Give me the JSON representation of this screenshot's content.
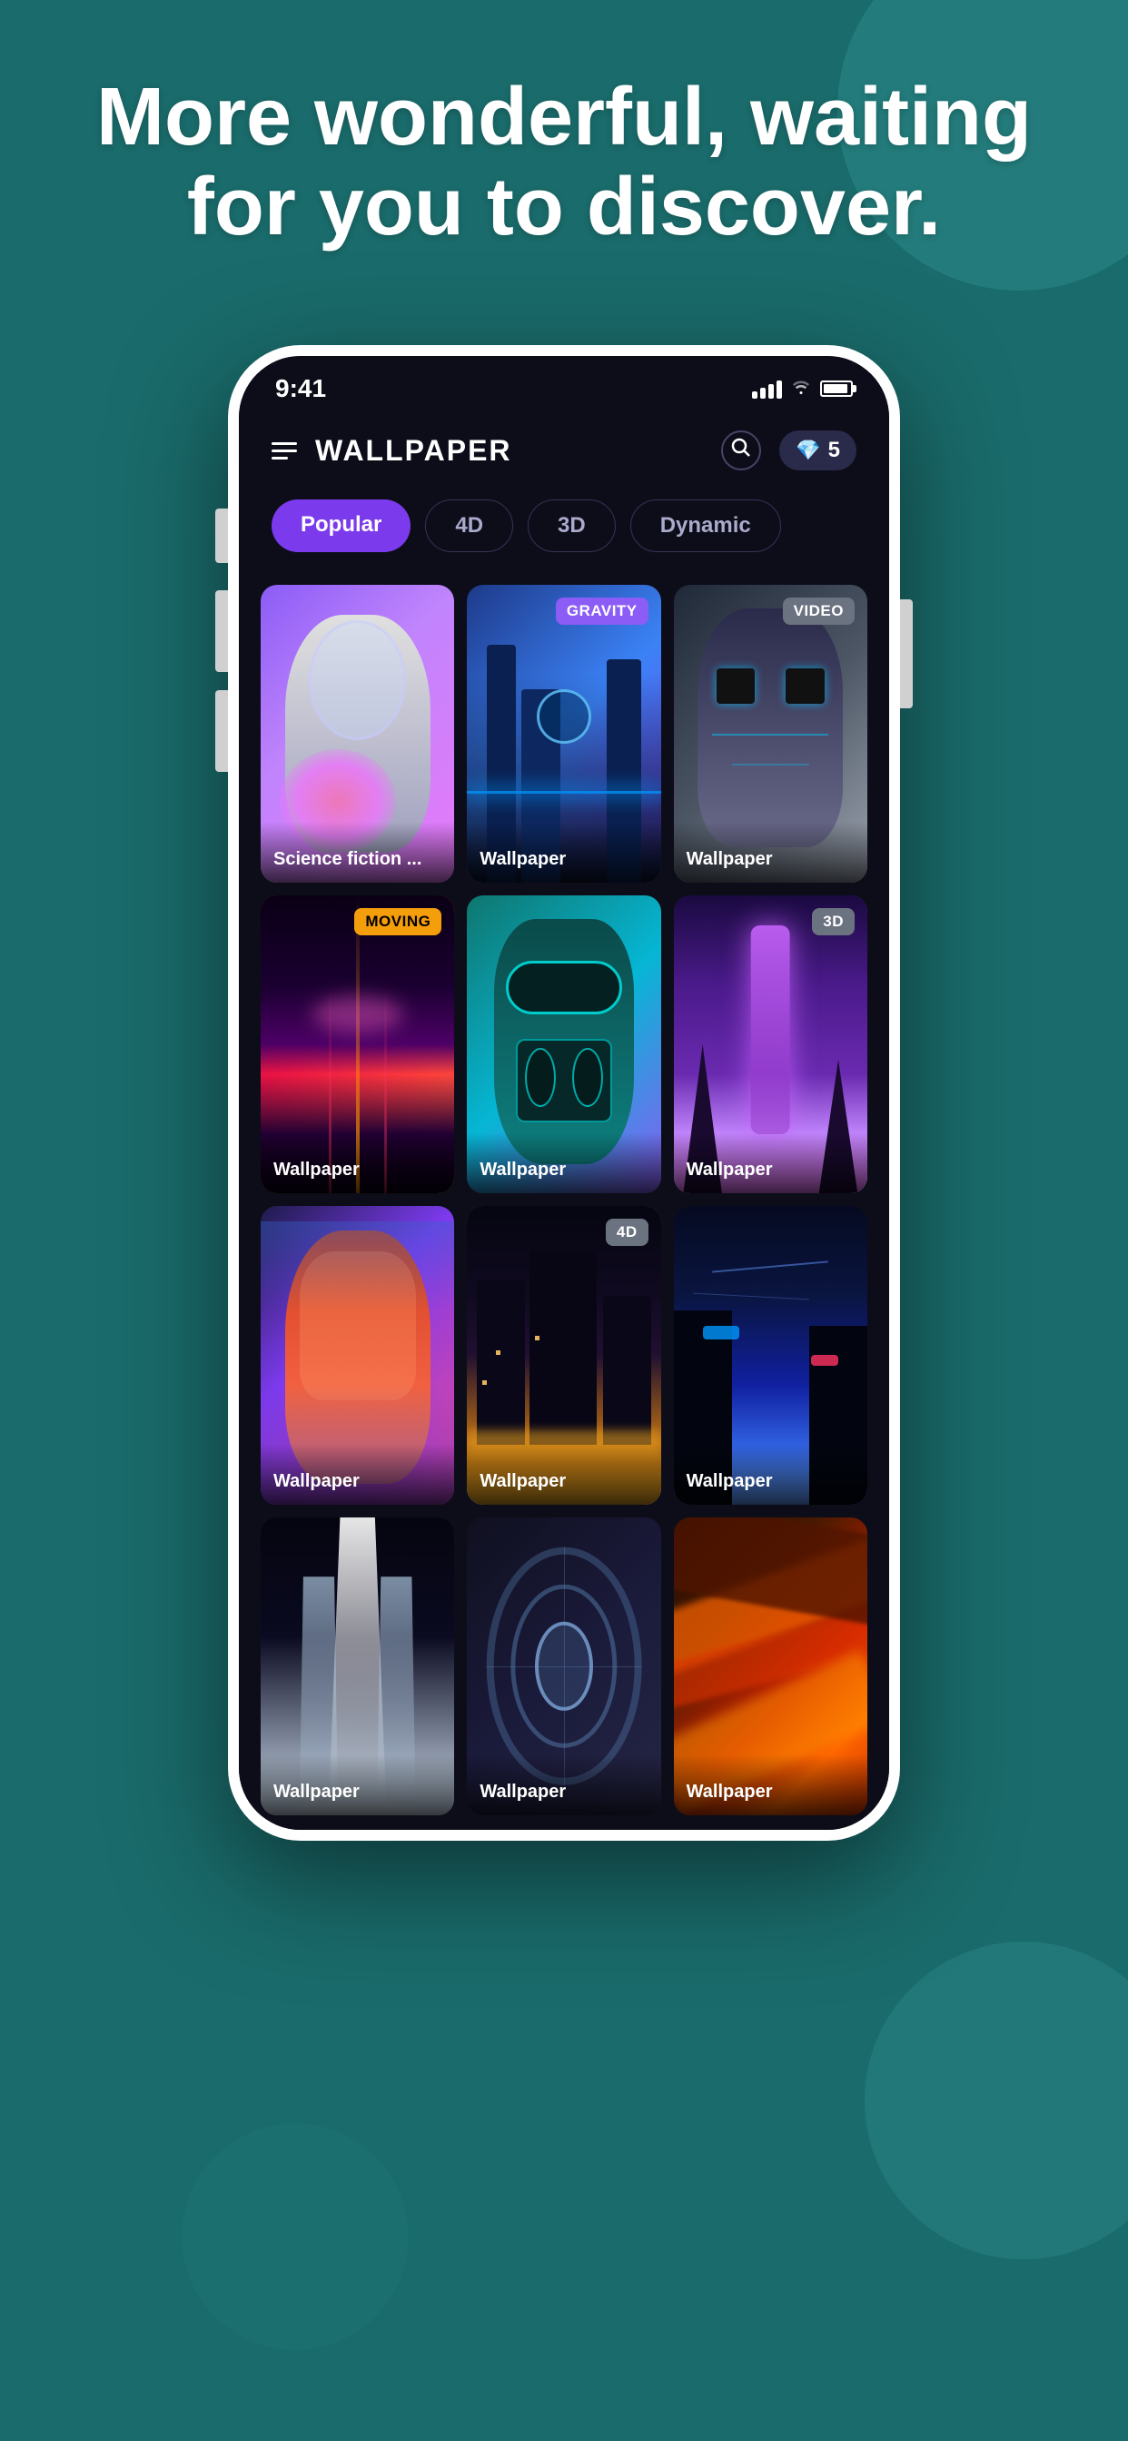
{
  "background": {
    "color": "#1a6b6b"
  },
  "hero": {
    "title": "More wonderful, waiting for you to discover."
  },
  "statusBar": {
    "time": "9:41",
    "signalLabel": "signal",
    "wifiLabel": "wifi",
    "batteryLabel": "battery"
  },
  "appHeader": {
    "title": "WALLPAPER",
    "searchLabel": "Search",
    "gemCount": "5"
  },
  "tabs": [
    {
      "label": "Popular",
      "active": true
    },
    {
      "label": "4D",
      "active": false
    },
    {
      "label": "3D",
      "active": false
    },
    {
      "label": "Dynamic",
      "active": false
    }
  ],
  "grid": {
    "items": [
      {
        "id": 1,
        "title": "Science fiction ...",
        "badge": null,
        "bg": "bg-1"
      },
      {
        "id": 2,
        "title": "Wallpaper",
        "badge": "GRAVITY",
        "badgeClass": "badge-gravity",
        "bg": "bg-2"
      },
      {
        "id": 3,
        "title": "Wallpaper",
        "badge": "VIDEO",
        "badgeClass": "badge-video",
        "bg": "bg-3"
      },
      {
        "id": 4,
        "title": "Wallpaper",
        "badge": "MOVING",
        "badgeClass": "badge-moving",
        "bg": "bg-4"
      },
      {
        "id": 5,
        "title": "Wallpaper",
        "badge": null,
        "bg": "bg-5"
      },
      {
        "id": 6,
        "title": "Wallpaper",
        "badge": "3D",
        "badgeClass": "badge-3d",
        "bg": "bg-6"
      },
      {
        "id": 7,
        "title": "Wallpaper",
        "badge": null,
        "bg": "bg-7"
      },
      {
        "id": 8,
        "title": "Wallpaper",
        "badge": "4D",
        "badgeClass": "badge-4d",
        "bg": "bg-8"
      },
      {
        "id": 9,
        "title": "Wallpaper",
        "badge": null,
        "bg": "bg-9"
      },
      {
        "id": 10,
        "title": "Wallpaper",
        "badge": null,
        "bg": "bg-10"
      },
      {
        "id": 11,
        "title": "Wallpaper",
        "badge": null,
        "bg": "bg-11"
      },
      {
        "id": 12,
        "title": "Wallpaper",
        "badge": null,
        "bg": "bg-12"
      }
    ]
  }
}
